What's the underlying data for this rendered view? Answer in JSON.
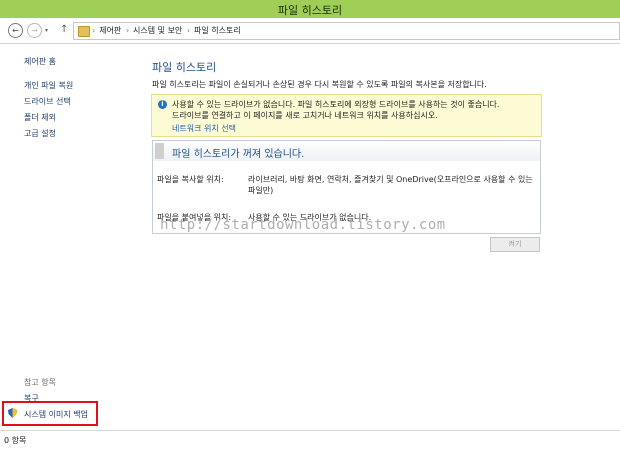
{
  "window": {
    "title": "파일 히스토리"
  },
  "nav": {
    "back": "←",
    "forward": "→",
    "dropdown": "▾",
    "up": "↑",
    "breadcrumb": [
      "제어판",
      "시스템 및 보안",
      "파일 히스토리"
    ],
    "separator": "›"
  },
  "sidebar": {
    "home": "제어판 홈",
    "items": [
      "개인 파일 복원",
      "드라이브 선택",
      "폴더 제외",
      "고급 설정"
    ],
    "see_also": "참고 항목",
    "see_also_items": [
      "복구",
      "시스템 이미지 백업"
    ],
    "highlight_color": "#e0101a"
  },
  "main": {
    "heading": "파일 히스토리",
    "description": "파일 히스토리는 파일이 손실되거나 손상된 경우 다시 복원할 수 있도록 파일의 복사본을 저장합니다.",
    "warning": {
      "icon": "i",
      "line1": "사용할 수 있는 드라이브가 없습니다. 파일 히스토리에 외장형 드라이브를 사용하는 것이 좋습니다.",
      "line2": "드라이브를 연결하고 이 페이지를 새로 고치거나 네트워크 위치를 사용하십시오.",
      "link": "네트워크 위치 선택"
    },
    "status_panel": {
      "title": "파일 히스토리가 꺼져 있습니다.",
      "copy_from_label": "파일을 복사할 위치:",
      "copy_from_value": "라이브러리, 바탕 화면, 연락처, 즐겨찾기 및 OneDrive(오프라인으로 사용할 수 있는 파일만)",
      "copy_to_label": "파일을 붙여넣을 위치:",
      "copy_to_value": "사용할 수 있는 드라이브가 없습니다."
    },
    "turn_on_button": "켜기"
  },
  "watermark": "http://startdownload.tistory.com",
  "status_bar": {
    "text": "0 항목"
  },
  "colors": {
    "titlebar": "#9fcf56",
    "link": "#1e3d6b",
    "heading": "#1f4e8a"
  }
}
